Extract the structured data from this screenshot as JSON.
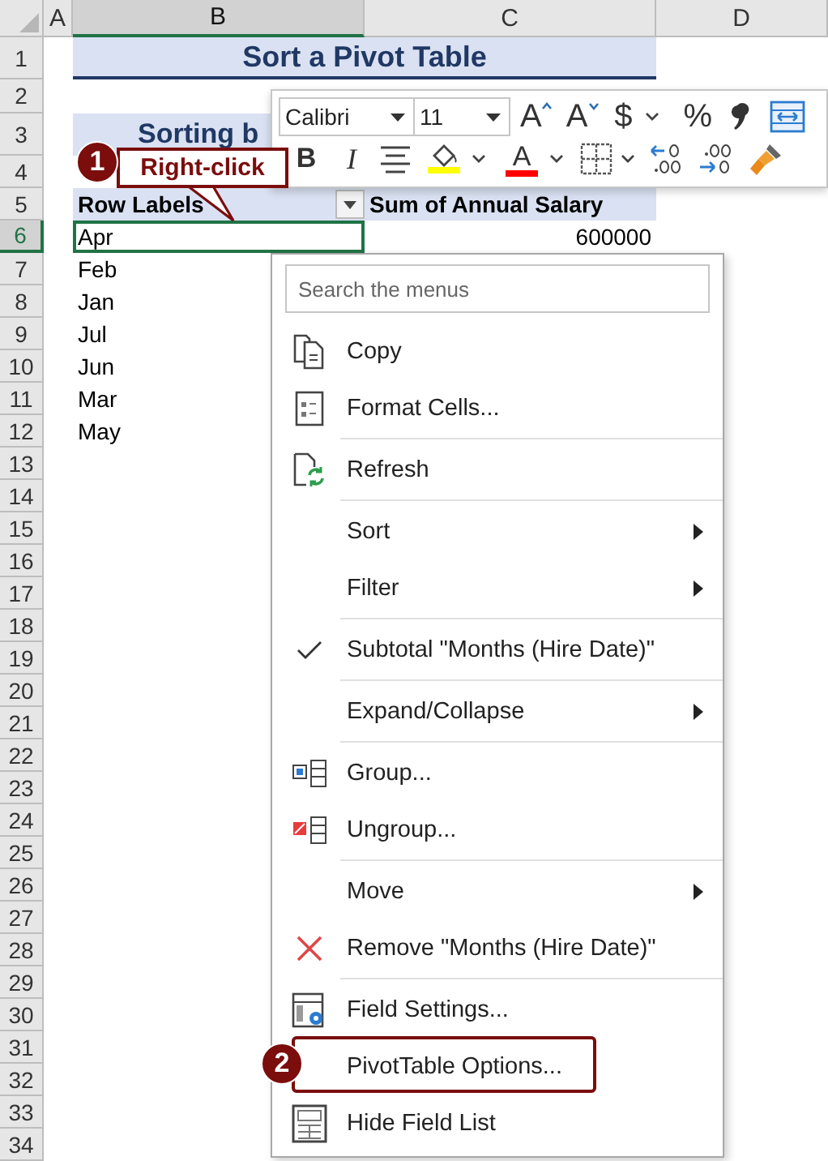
{
  "sheet": {
    "columns": [
      {
        "label": "A",
        "selected": false
      },
      {
        "label": "B",
        "selected": true
      },
      {
        "label": "C",
        "selected": false
      },
      {
        "label": "D",
        "selected": false
      }
    ],
    "rows": [
      {
        "label": "1",
        "selected": false,
        "cells": [
          {
            "kind": "title",
            "text": "Sort a Pivot Table",
            "active": false
          }
        ]
      },
      {
        "label": "2",
        "selected": false,
        "cells": []
      },
      {
        "label": "3",
        "selected": false,
        "cells": [
          {
            "kind": "subtitle",
            "text": "Sorting b",
            "active": false
          }
        ]
      },
      {
        "label": "4",
        "selected": false,
        "cells": []
      },
      {
        "label": "5",
        "selected": false,
        "cells": [
          {
            "kind": "header",
            "text": "Row Labels",
            "active": false
          },
          {
            "kind": "header-value",
            "text": "Sum of Annual Salary",
            "active": false
          }
        ]
      },
      {
        "label": "6",
        "selected": true,
        "cells": [
          {
            "kind": "label",
            "text": "Apr",
            "active": true
          },
          {
            "kind": "value",
            "text": "600000",
            "active": false
          }
        ]
      },
      {
        "label": "7",
        "selected": false,
        "cells": [
          {
            "kind": "label",
            "text": "Feb",
            "active": false
          }
        ]
      },
      {
        "label": "8",
        "selected": false,
        "cells": [
          {
            "kind": "label",
            "text": "Jan",
            "active": false
          }
        ]
      },
      {
        "label": "9",
        "selected": false,
        "cells": [
          {
            "kind": "label",
            "text": "Jul",
            "active": false
          }
        ]
      },
      {
        "label": "10",
        "selected": false,
        "cells": [
          {
            "kind": "label",
            "text": "Jun",
            "active": false
          }
        ]
      },
      {
        "label": "11",
        "selected": false,
        "cells": [
          {
            "kind": "label",
            "text": "Mar",
            "active": false
          }
        ]
      },
      {
        "label": "12",
        "selected": false,
        "cells": [
          {
            "kind": "label",
            "text": "May",
            "active": false
          }
        ]
      },
      {
        "label": "13",
        "selected": false,
        "cells": []
      },
      {
        "label": "14",
        "selected": false,
        "cells": []
      },
      {
        "label": "15",
        "selected": false,
        "cells": []
      },
      {
        "label": "16",
        "selected": false,
        "cells": []
      },
      {
        "label": "17",
        "selected": false,
        "cells": []
      },
      {
        "label": "18",
        "selected": false,
        "cells": []
      },
      {
        "label": "19",
        "selected": false,
        "cells": []
      },
      {
        "label": "20",
        "selected": false,
        "cells": []
      },
      {
        "label": "21",
        "selected": false,
        "cells": []
      },
      {
        "label": "22",
        "selected": false,
        "cells": []
      },
      {
        "label": "23",
        "selected": false,
        "cells": []
      },
      {
        "label": "24",
        "selected": false,
        "cells": []
      },
      {
        "label": "25",
        "selected": false,
        "cells": []
      },
      {
        "label": "26",
        "selected": false,
        "cells": []
      },
      {
        "label": "27",
        "selected": false,
        "cells": []
      },
      {
        "label": "28",
        "selected": false,
        "cells": []
      },
      {
        "label": "29",
        "selected": false,
        "cells": []
      },
      {
        "label": "30",
        "selected": false,
        "cells": []
      },
      {
        "label": "31",
        "selected": false,
        "cells": []
      },
      {
        "label": "32",
        "selected": false,
        "cells": []
      },
      {
        "label": "33",
        "selected": false,
        "cells": []
      },
      {
        "label": "34",
        "selected": false,
        "cells": []
      }
    ]
  },
  "mini_toolbar": {
    "font": "Calibri",
    "size": "11",
    "row_1": [
      {
        "kind": "grow-font",
        "text": "A"
      },
      {
        "kind": "shrink-font",
        "text": "A"
      },
      {
        "kind": "currency",
        "text": "$"
      },
      {
        "kind": "dropdown"
      },
      {
        "kind": "percent",
        "text": "%"
      },
      {
        "kind": "comma-style"
      },
      {
        "kind": "wrap"
      }
    ],
    "row_2": [
      {
        "kind": "bold",
        "text": "B"
      },
      {
        "kind": "italic",
        "text": "I"
      },
      {
        "kind": "center"
      },
      {
        "kind": "fill-color",
        "color": "#ffff00"
      },
      {
        "kind": "dropdown"
      },
      {
        "kind": "font-color",
        "text": "A",
        "color": "#ff0000"
      },
      {
        "kind": "dropdown"
      },
      {
        "kind": "borders"
      },
      {
        "kind": "dropdown"
      },
      {
        "kind": "increase-decimal"
      },
      {
        "kind": "decrease-decimal"
      },
      {
        "kind": "format-painter"
      }
    ]
  },
  "context_menu": {
    "search": {
      "placeholder": "Search the menus"
    },
    "items": [
      {
        "kind": "item",
        "label": "Copy",
        "submenu": false,
        "checked": false
      },
      {
        "kind": "item",
        "label": "Format Cells...",
        "submenu": false,
        "checked": false
      },
      {
        "kind": "separator"
      },
      {
        "kind": "item",
        "label": "Refresh",
        "submenu": false,
        "checked": false
      },
      {
        "kind": "separator"
      },
      {
        "kind": "item",
        "label": "Sort",
        "submenu": true,
        "checked": false
      },
      {
        "kind": "item",
        "label": "Filter",
        "submenu": true,
        "checked": false
      },
      {
        "kind": "separator"
      },
      {
        "kind": "item",
        "label": "Subtotal \"Months (Hire Date)\"",
        "submenu": false,
        "checked": true
      },
      {
        "kind": "separator"
      },
      {
        "kind": "item",
        "label": "Expand/Collapse",
        "submenu": true,
        "checked": false
      },
      {
        "kind": "separator"
      },
      {
        "kind": "item",
        "label": "Group...",
        "submenu": false,
        "checked": false
      },
      {
        "kind": "item",
        "label": "Ungroup...",
        "submenu": false,
        "checked": false
      },
      {
        "kind": "separator"
      },
      {
        "kind": "item",
        "label": "Move",
        "submenu": true,
        "checked": false
      },
      {
        "kind": "item",
        "label": "Remove \"Months (Hire Date)\"",
        "submenu": false,
        "checked": false
      },
      {
        "kind": "separator"
      },
      {
        "kind": "item",
        "label": "Field Settings...",
        "submenu": false,
        "checked": false
      },
      {
        "kind": "item",
        "label": "PivotTable Options...",
        "submenu": false,
        "checked": false
      },
      {
        "kind": "item",
        "label": "Hide Field List",
        "submenu": false,
        "checked": false
      }
    ]
  },
  "callouts": [
    {
      "number": "1",
      "text": "Right-click"
    },
    {
      "number": "2"
    }
  ]
}
